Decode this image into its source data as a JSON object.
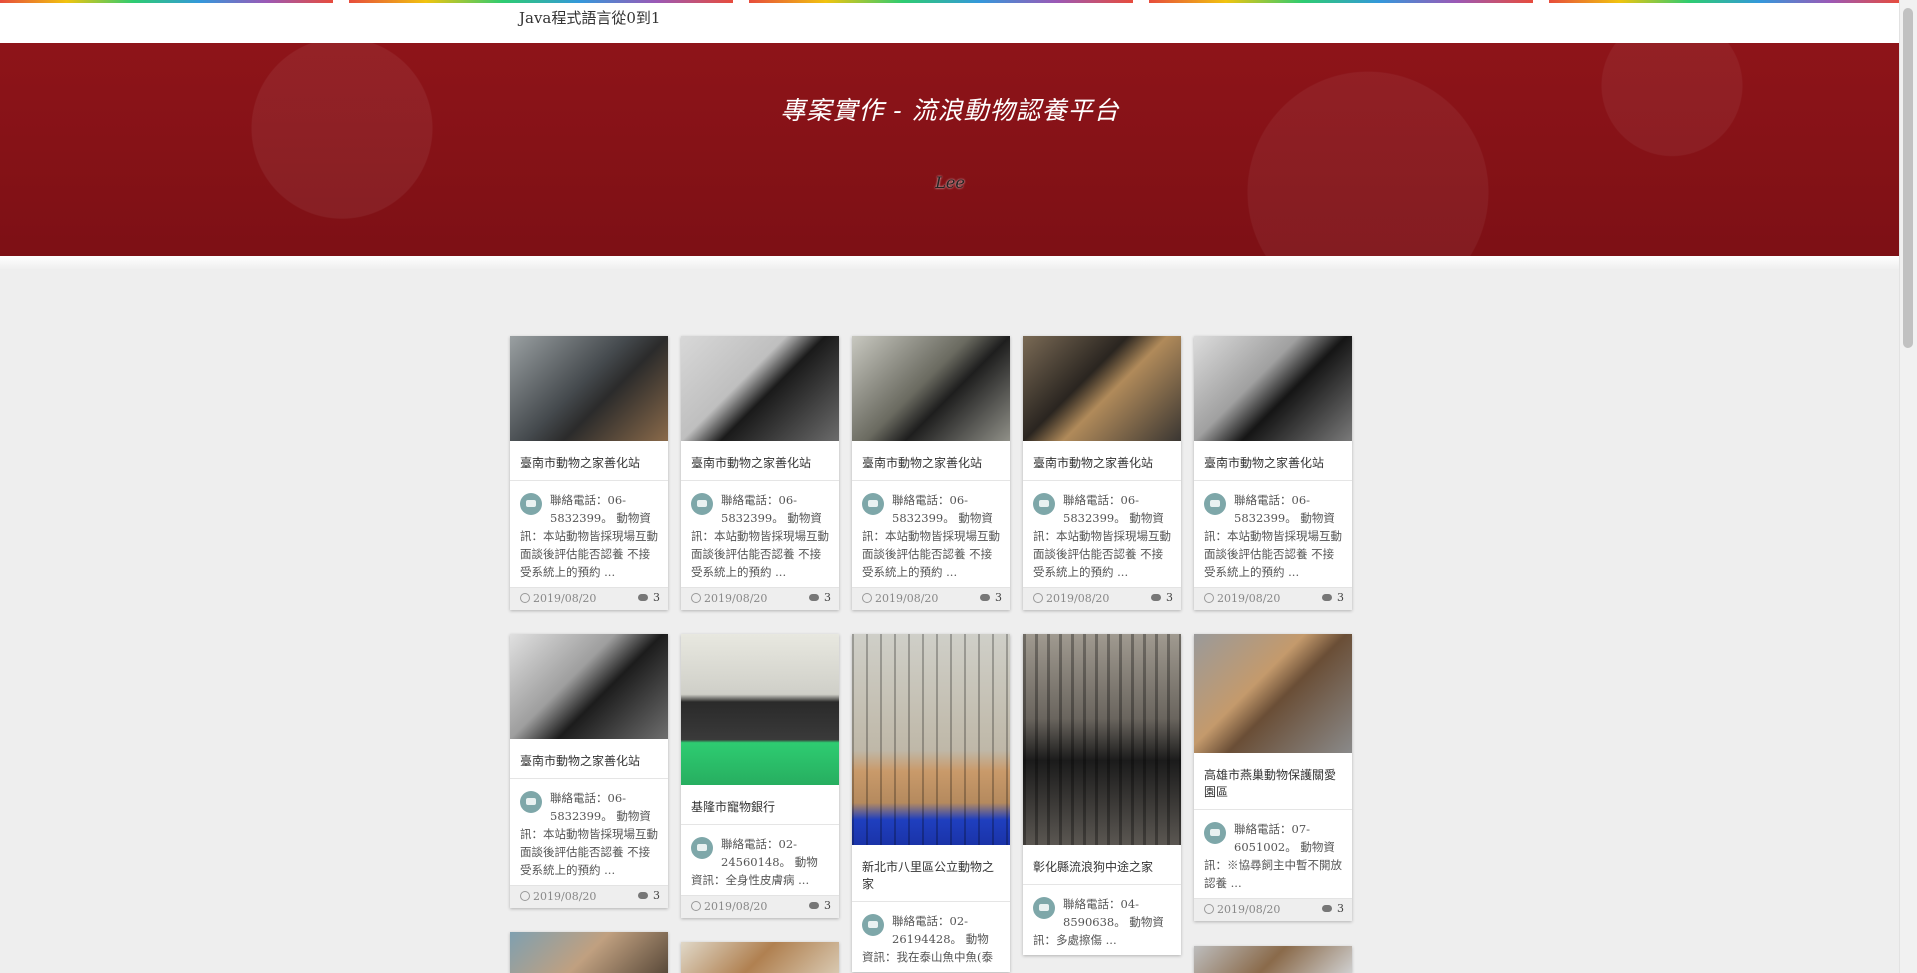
{
  "topbar": {
    "link": "Java程式語言從0到1"
  },
  "hero": {
    "title": "專案實作 - 流浪動物認養平台",
    "subtitle": "Lee"
  },
  "colors": {
    "accent": "#8e1419",
    "background": "#eeeeee"
  },
  "cards": [
    {
      "title": "臺南市動物之家善化站",
      "excerpt": "聯絡電話：06-5832399。 動物資訊：本站動物皆採現場互動面談後評估能否認養 不接受系統上的預約 ...",
      "date": "2019/08/20",
      "comments": "3"
    },
    {
      "title": "臺南市動物之家善化站",
      "excerpt": "聯絡電話：06-5832399。 動物資訊：本站動物皆採現場互動面談後評估能否認養 不接受系統上的預約 ...",
      "date": "2019/08/20",
      "comments": "3"
    },
    {
      "title": "臺南市動物之家善化站",
      "excerpt": "聯絡電話：06-5832399。 動物資訊：本站動物皆採現場互動面談後評估能否認養 不接受系統上的預約 ...",
      "date": "2019/08/20",
      "comments": "3"
    },
    {
      "title": "臺南市動物之家善化站",
      "excerpt": "聯絡電話：06-5832399。 動物資訊：本站動物皆採現場互動面談後評估能否認養 不接受系統上的預約 ...",
      "date": "2019/08/20",
      "comments": "3"
    },
    {
      "title": "臺南市動物之家善化站",
      "excerpt": "聯絡電話：06-5832399。 動物資訊：本站動物皆採現場互動面談後評估能否認養 不接受系統上的預約 ...",
      "date": "2019/08/20",
      "comments": "3"
    },
    {
      "title": "臺南市動物之家善化站",
      "excerpt": "聯絡電話：06-5832399。 動物資訊：本站動物皆採現場互動面談後評估能否認養 不接受系統上的預約 ...",
      "date": "2019/08/20",
      "comments": "3"
    },
    {
      "title": "基隆市寵物銀行",
      "excerpt": "聯絡電話：02-24560148。 動物資訊：全身性皮膚病 ...",
      "date": "2019/08/20",
      "comments": "3"
    },
    {
      "title": "新北市八里區公立動物之家",
      "excerpt": "聯絡電話：02-26194428。 動物資訊：我在泰山魚中魚(泰",
      "date": "",
      "comments": ""
    },
    {
      "title": "彰化縣流浪狗中途之家",
      "excerpt": "聯絡電話：04-8590638。 動物資訊：多處擦傷 ...",
      "date": "",
      "comments": ""
    },
    {
      "title": "高雄市燕巢動物保護關愛園區",
      "excerpt": "聯絡電話：07-6051002。 動物資訊：※協尋飼主中暫不開放認養 ...",
      "date": "2019/08/20",
      "comments": "3"
    }
  ]
}
